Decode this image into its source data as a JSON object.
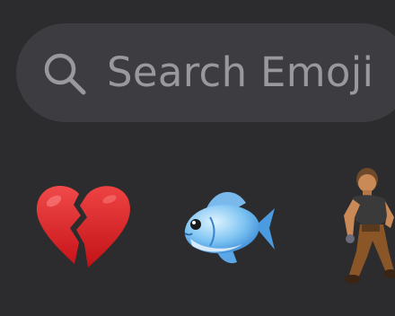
{
  "search": {
    "placeholder": "Search Emoji"
  },
  "emojis": [
    {
      "name": "broken-heart"
    },
    {
      "name": "fish"
    },
    {
      "name": "man-dancing"
    }
  ],
  "colors": {
    "background": "#2c2c2e",
    "search_bar": "#3d3d41",
    "placeholder": "#98989d"
  }
}
